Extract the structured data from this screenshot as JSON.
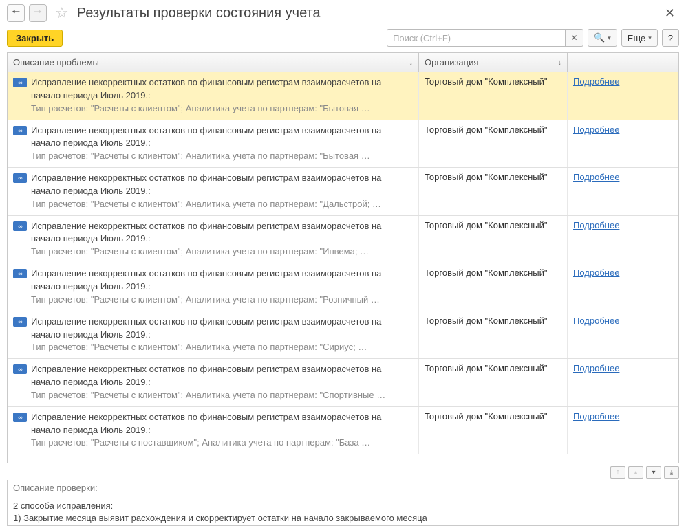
{
  "title": "Результаты проверки состояния учета",
  "toolbar": {
    "close_label": "Закрыть",
    "search_placeholder": "Поиск (Ctrl+F)",
    "more_label": "Еще",
    "help_label": "?"
  },
  "columns": {
    "description": "Описание проблемы",
    "organization": "Организация"
  },
  "details_link": "Подробнее",
  "rows": [
    {
      "line1": "Исправление некорректных остатков по финансовым регистрам взаиморасчетов на начало периода Июль 2019.:",
      "line2": "Тип расчетов: \"Расчеты с клиентом\"; Аналитика учета по партнерам: \"Бытовая …",
      "org": "Торговый дом \"Комплексный\"",
      "selected": true
    },
    {
      "line1": "Исправление некорректных остатков по финансовым регистрам взаиморасчетов на начало периода Июль 2019.:",
      "line2": "Тип расчетов: \"Расчеты с клиентом\"; Аналитика учета по партнерам: \"Бытовая …",
      "org": "Торговый дом \"Комплексный\"",
      "selected": false
    },
    {
      "line1": "Исправление некорректных остатков по финансовым регистрам взаиморасчетов на начало периода Июль 2019.:",
      "line2": "Тип расчетов: \"Расчеты с клиентом\"; Аналитика учета по партнерам: \"Дальстрой; …",
      "org": "Торговый дом \"Комплексный\"",
      "selected": false
    },
    {
      "line1": "Исправление некорректных остатков по финансовым регистрам взаиморасчетов на начало периода Июль 2019.:",
      "line2": "Тип расчетов: \"Расчеты с клиентом\"; Аналитика учета по партнерам: \"Инвема; …",
      "org": "Торговый дом \"Комплексный\"",
      "selected": false
    },
    {
      "line1": "Исправление некорректных остатков по финансовым регистрам взаиморасчетов на начало периода Июль 2019.:",
      "line2": "Тип расчетов: \"Расчеты с клиентом\"; Аналитика учета по партнерам: \"Розничный …",
      "org": "Торговый дом \"Комплексный\"",
      "selected": false
    },
    {
      "line1": "Исправление некорректных остатков по финансовым регистрам взаиморасчетов на начало периода Июль 2019.:",
      "line2": "Тип расчетов: \"Расчеты с клиентом\"; Аналитика учета по партнерам: \"Сириус; …",
      "org": "Торговый дом \"Комплексный\"",
      "selected": false
    },
    {
      "line1": "Исправление некорректных остатков по финансовым регистрам взаиморасчетов на начало периода Июль 2019.:",
      "line2": "Тип расчетов: \"Расчеты с клиентом\"; Аналитика учета по партнерам: \"Спортивные …",
      "org": "Торговый дом \"Комплексный\"",
      "selected": false
    },
    {
      "line1": "Исправление некорректных остатков по финансовым регистрам взаиморасчетов на начало периода Июль 2019.:",
      "line2": "Тип расчетов: \"Расчеты с поставщиком\"; Аналитика учета по партнерам: \"База …",
      "org": "Торговый дом \"Комплексный\"",
      "selected": false
    }
  ],
  "check_description": {
    "label": "Описание проверки:",
    "line1": "2 способа исправления:",
    "line2": "1) Закрытие месяца выявит расхождения и скорректирует остатки на начало закрываемого месяца"
  }
}
